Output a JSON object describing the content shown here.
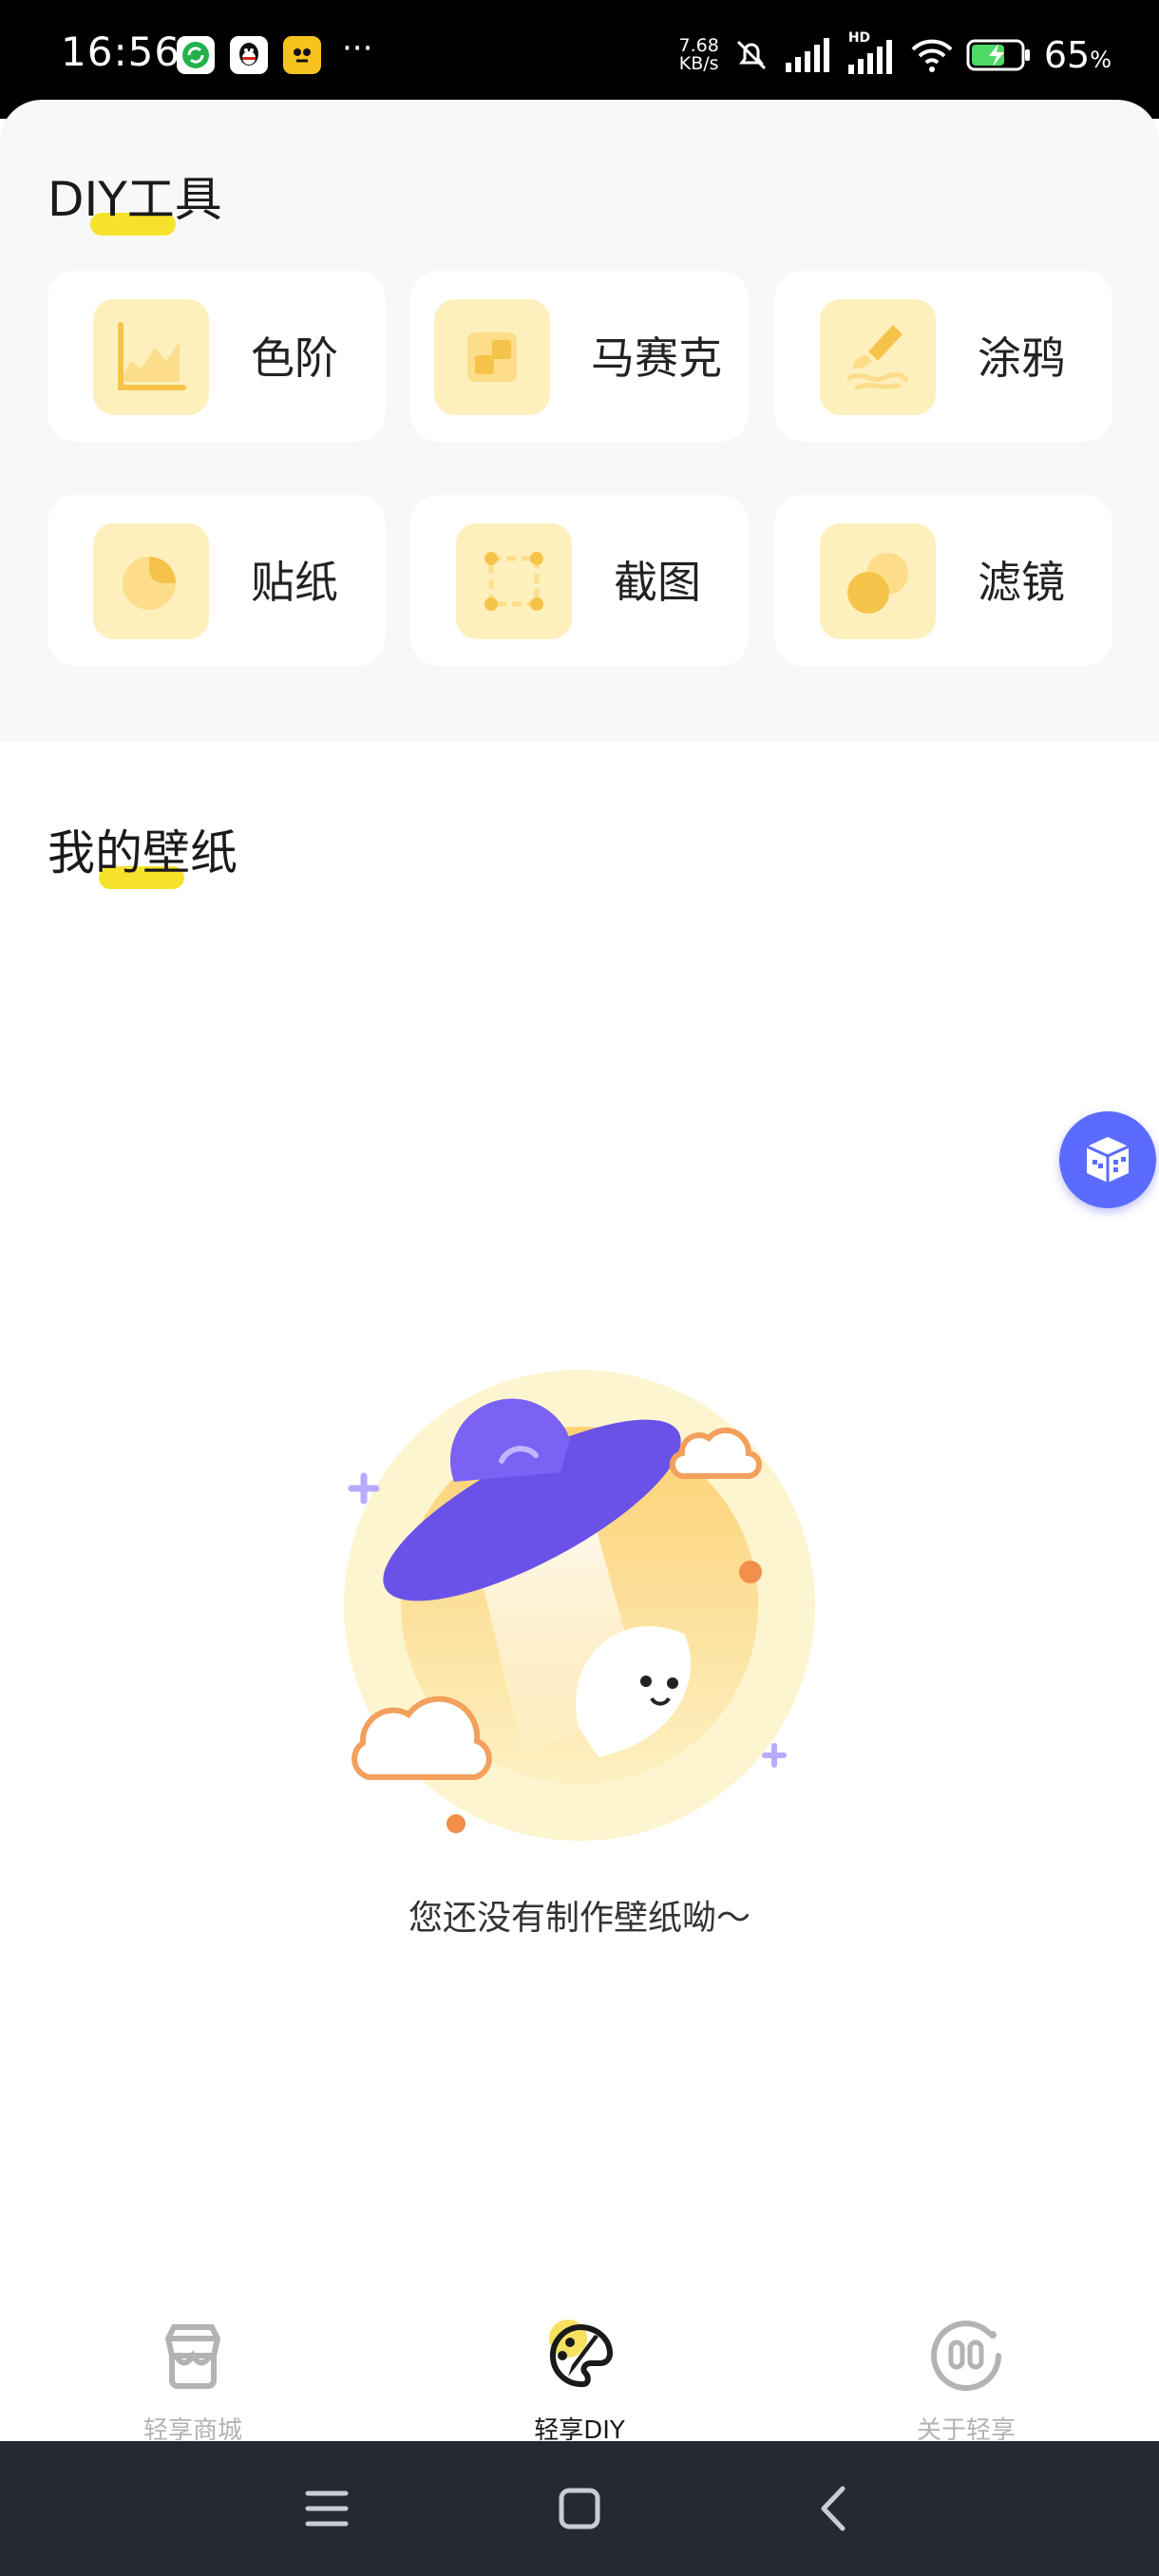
{
  "status_bar": {
    "time": "16:56",
    "net_speed_value": "7.68",
    "net_speed_unit": "KB/s",
    "network": "HD",
    "battery_percent": "65",
    "battery_unit": "%"
  },
  "diy_tools": {
    "title": "DIY工具",
    "items": [
      {
        "label": "色阶",
        "icon": "levels-icon"
      },
      {
        "label": "马赛克",
        "icon": "mosaic-icon"
      },
      {
        "label": "涂鸦",
        "icon": "brush-icon"
      },
      {
        "label": "贴纸",
        "icon": "sticker-icon"
      },
      {
        "label": "截图",
        "icon": "crop-icon"
      },
      {
        "label": "滤镜",
        "icon": "filter-icon"
      }
    ]
  },
  "my_wallpapers": {
    "title": "我的壁纸",
    "empty_message": "您还没有制作壁纸呦～"
  },
  "bottom_nav": {
    "items": [
      {
        "label": "轻享商城",
        "icon": "store-icon",
        "active": false
      },
      {
        "label": "轻享DIY",
        "icon": "palette-icon",
        "active": true
      },
      {
        "label": "关于轻享",
        "icon": "smile-face-icon",
        "active": false
      }
    ]
  },
  "colors": {
    "accent_yellow": "#f7e22b",
    "icon_bg": "#fdf0bd",
    "icon_fg": "#f6c34a",
    "float_button": "#5c6bff",
    "system_nav": "#262933"
  }
}
